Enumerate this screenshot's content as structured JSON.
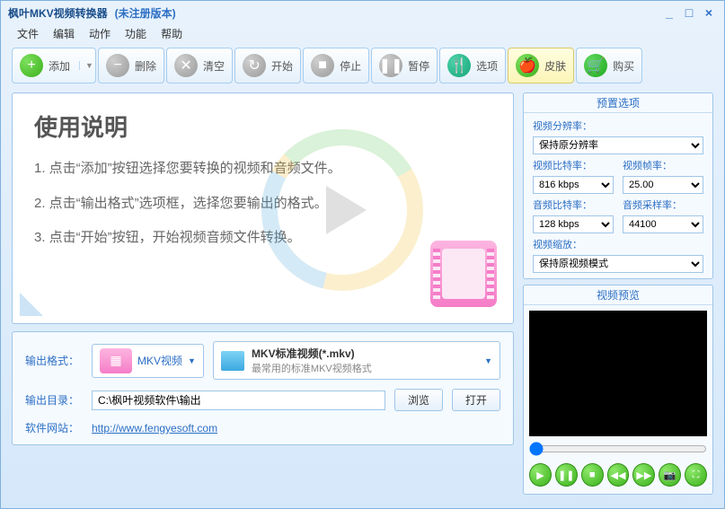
{
  "title": "枫叶MKV视频转换器",
  "unregistered": "(未注册版本)",
  "menu": [
    "文件",
    "编辑",
    "动作",
    "功能",
    "帮助"
  ],
  "toolbar": {
    "add": "添加",
    "delete": "删除",
    "clear": "清空",
    "start": "开始",
    "stop": "停止",
    "pause": "暂停",
    "options": "选项",
    "skin": "皮肤",
    "buy": "购买"
  },
  "instructions": {
    "heading": "使用说明",
    "step1": "1. 点击“添加”按钮选择您要转换的视频和音频文件。",
    "step2": "2. 点击“输出格式”选项框，选择您要输出的格式。",
    "step3": "3. 点击“开始”按钮，开始视频音频文件转换。"
  },
  "output": {
    "format_label": "输出格式：",
    "format_value": "MKV视频",
    "format_title": "MKV标准视频(*.mkv)",
    "format_sub": "最常用的标准MKV视频格式",
    "dir_label": "输出目录：",
    "dir_value": "C:\\枫叶视频软件\\输出",
    "browse": "浏览",
    "open": "打开",
    "site_label": "软件网站：",
    "site_url": "http://www.fengyesoft.com"
  },
  "preset": {
    "title": "预置选项",
    "res_label": "视频分辨率：",
    "res_value": "保持原分辨率",
    "vbr_label": "视频比特率：",
    "vbr_value": "816 kbps",
    "fps_label": "视频帧率：",
    "fps_value": "25.00",
    "abr_label": "音频比特率：",
    "abr_value": "128 kbps",
    "asr_label": "音频采样率：",
    "asr_value": "44100",
    "zoom_label": "视频缩放：",
    "zoom_value": "保持原视频模式"
  },
  "preview": {
    "title": "视频预览"
  }
}
